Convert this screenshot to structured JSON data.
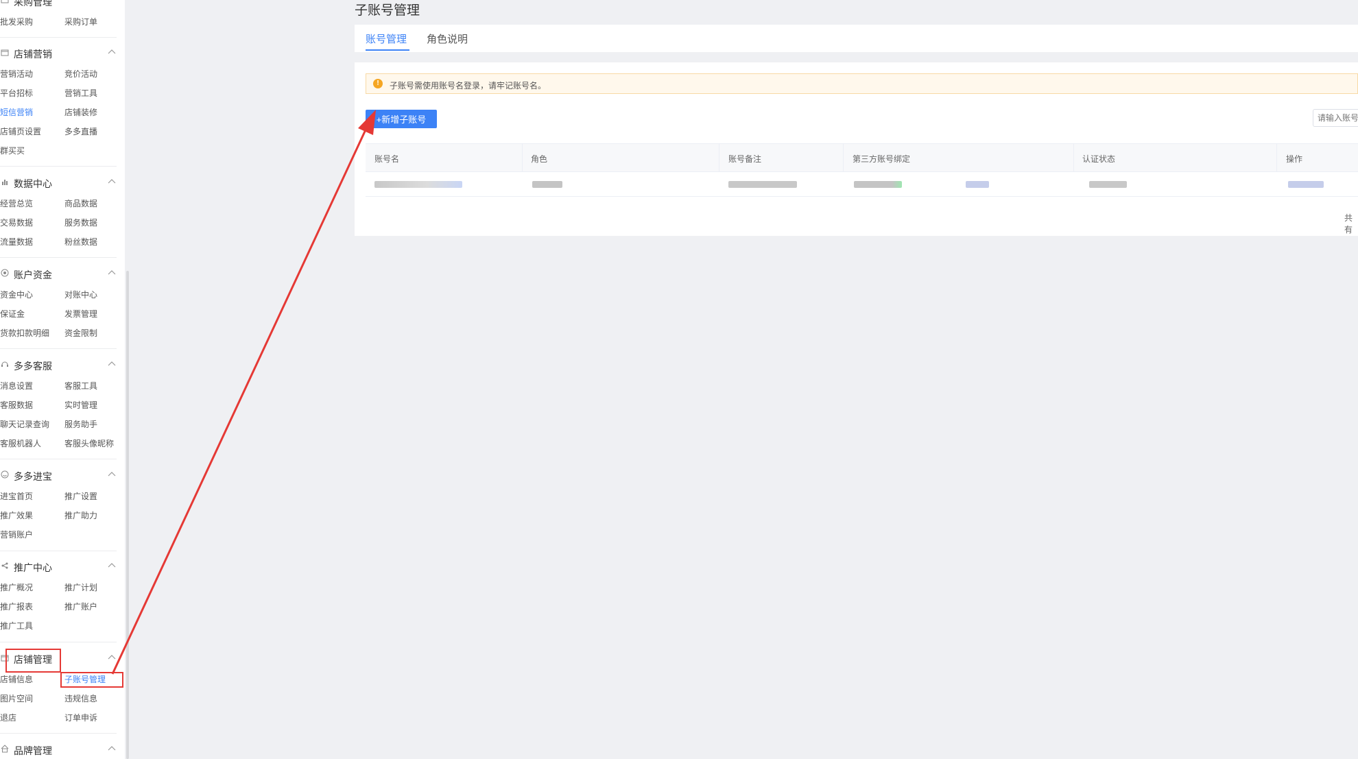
{
  "sidebar": {
    "groups": [
      {
        "title": "采购管理",
        "icon": "cart-icon",
        "items": [
          "批发采购",
          "采购订单"
        ]
      },
      {
        "title": "店铺营销",
        "icon": "store-icon",
        "items": [
          "营销活动",
          "竞价活动",
          "平台招标",
          "营销工具",
          "短信营销",
          "店铺装修",
          "店铺页设置",
          "多多直播",
          "群买买"
        ],
        "active": "短信营销"
      },
      {
        "title": "数据中心",
        "icon": "bar-chart-icon",
        "items": [
          "经营总览",
          "商品数据",
          "交易数据",
          "服务数据",
          "流量数据",
          "粉丝数据"
        ]
      },
      {
        "title": "账户资金",
        "icon": "coin-icon",
        "items": [
          "资金中心",
          "对账中心",
          "保证金",
          "发票管理",
          "货款扣款明细",
          "资金限制"
        ]
      },
      {
        "title": "多多客服",
        "icon": "headset-icon",
        "items": [
          "消息设置",
          "客服工具",
          "客服数据",
          "实时管理",
          "聊天记录查询",
          "服务助手",
          "客服机器人",
          "客服头像昵称"
        ]
      },
      {
        "title": "多多进宝",
        "icon": "smile-icon",
        "items": [
          "进宝首页",
          "推广设置",
          "推广效果",
          "推广助力",
          "营销账户"
        ]
      },
      {
        "title": "推广中心",
        "icon": "share-icon",
        "items": [
          "推广概况",
          "推广计划",
          "推广报表",
          "推广账户",
          "推广工具"
        ]
      },
      {
        "title": "店铺管理",
        "icon": "shop-icon",
        "items": [
          "店铺信息",
          "子账号管理",
          "图片空间",
          "违规信息",
          "退店",
          "订单申诉"
        ],
        "active": "子账号管理"
      },
      {
        "title": "品牌管理",
        "icon": "home-icon",
        "items": []
      }
    ]
  },
  "page": {
    "title": "子账号管理",
    "tabs": [
      "账号管理",
      "角色说明"
    ],
    "notice": "子账号需使用账号名登录，请牢记账号名。",
    "add_button": "+新增子账号",
    "search_placeholder": "请输入账号",
    "table": {
      "columns": [
        "账号名",
        "角色",
        "账号备注",
        "第三方账号绑定",
        "认证状态",
        "操作"
      ]
    },
    "total": "共有"
  },
  "colors": {
    "accent": "#3c82f6",
    "annotation": "#e53935",
    "warning": "#f5a623"
  }
}
